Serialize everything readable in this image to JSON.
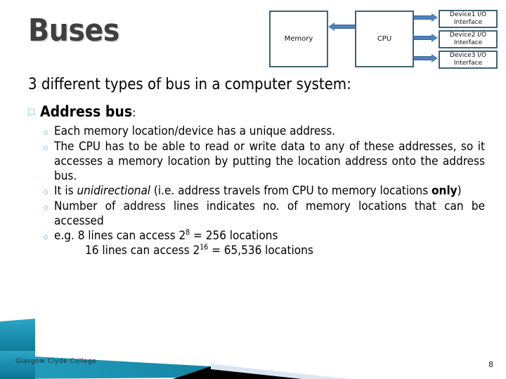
{
  "slide": {
    "title": "Buses",
    "page_number": "8",
    "footer": "Glasgow Clyde College",
    "accent_color": "#4f81bd",
    "box_border_color": "#3f6272",
    "title_color": "#3f3f3f",
    "bullet_color": "#9fd3e2",
    "banner_color": "#1a8fae"
  },
  "diagram": {
    "memory_label": "Memory",
    "cpu_label": "CPU",
    "devices": [
      "Device1 I/O Interface",
      "Device2 I/O Interface",
      "Device3 I/O Interface"
    ],
    "arrows": {
      "cpu_to_memory": "left",
      "cpu_to_device1": "right",
      "cpu_to_device2": "right",
      "cpu_to_device3": "right"
    }
  },
  "body": {
    "lead": "3 different types of bus in a computer system:",
    "heading": "Address bus",
    "heading_tail": ":",
    "bullets": {
      "b1": "Each memory location/device has a unique address.",
      "b2_a": "The CPU has to be able to read or write data to any of these addresses, so it accesses a memory location by putting the location address onto the address bus.",
      "b3_pre": "It is ",
      "b3_italic": "unidirectional",
      "b3_mid": " (i.e. address travels from CPU to memory locations ",
      "b3_bold": "only",
      "b3_post": ")",
      "b4": "Number of address lines indicates no. of memory locations that can be accessed",
      "b5_line1": "e.g. 8 lines can access 2",
      "b5_line1_sup": "8",
      "b5_line1_rest": " = 256 locations",
      "b5_line2": "16 lines can access 2",
      "b5_line2_sup": "16",
      "b5_line2_rest": " = 65,536 locations"
    }
  }
}
